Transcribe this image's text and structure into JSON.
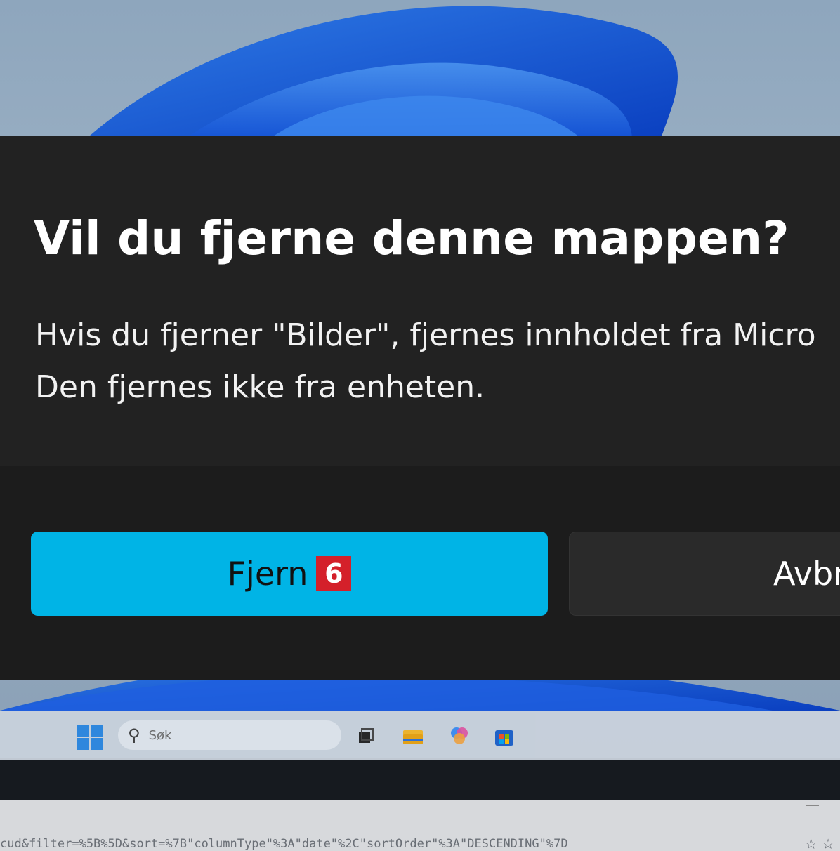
{
  "dialog": {
    "title": "Vil du fjerne denne mappen?",
    "body_line1": "Hvis du fjerner \"Bilder\", fjernes innholdet fra Micro",
    "body_line2": "Den fjernes ikke fra enheten.",
    "primary_button": "Fjern",
    "secondary_button": "Avbryt",
    "step_badge": "6",
    "primary_color": "#00b4e6",
    "badge_color": "#d4202a"
  },
  "taskbar": {
    "search_label": "Søk",
    "search_icon": "search-icon",
    "icons": [
      "windows-start-icon",
      "task-view-icon",
      "file-explorer-icon",
      "copilot-icon",
      "microsoft-store-icon"
    ]
  },
  "status_bar": {
    "url": "cud&filter=%5B%5D&sort=%7B\"columnType\"%3A\"date\"%2C\"sortOrder\"%3A\"DESCENDING\"%7D",
    "icons": "☆ ☆"
  }
}
